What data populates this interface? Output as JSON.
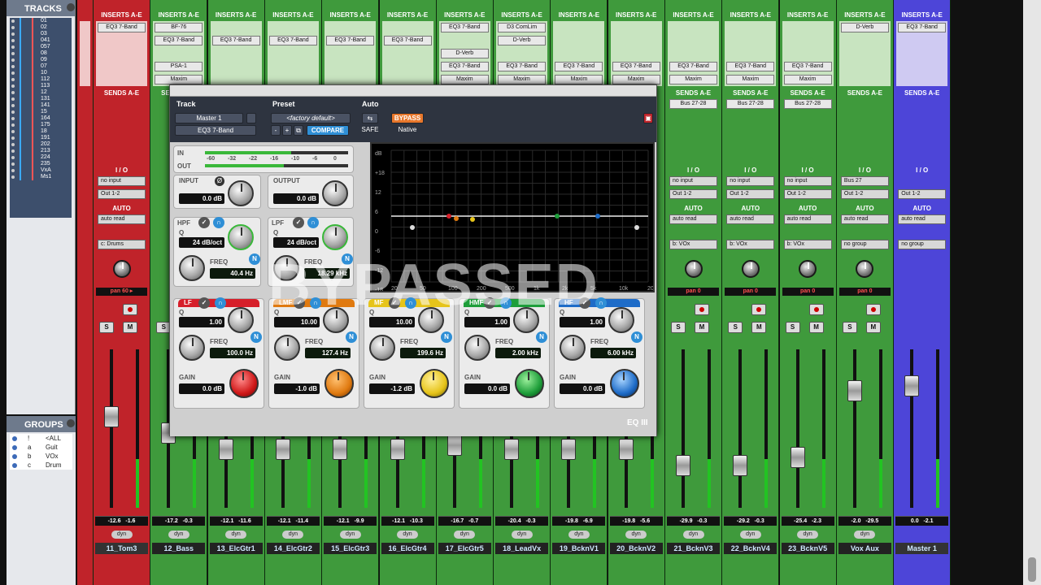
{
  "tracks_panel": {
    "title": "TRACKS",
    "items": [
      "01",
      "02",
      "03",
      "041",
      "057",
      "08",
      "09",
      "07",
      "10",
      "112",
      "113",
      "12",
      "131",
      "141",
      "15",
      "164",
      "175",
      "18",
      "191",
      "202",
      "213",
      "224",
      "235",
      "VxA",
      "Ms1"
    ]
  },
  "groups_panel": {
    "title": "GROUPS",
    "items": [
      {
        "key": "!",
        "name": "<ALL"
      },
      {
        "key": "a",
        "name": "Guit"
      },
      {
        "key": "b",
        "name": "VOx"
      },
      {
        "key": "c",
        "name": "Drum"
      }
    ]
  },
  "common": {
    "inserts_header": "INSERTS A-E",
    "sends_header": "SENDS A-E",
    "io_label": "I / O",
    "auto_label": "AUTO",
    "solo": "S",
    "mute": "M",
    "dyn": "dyn"
  },
  "channels": [
    {
      "name": "11_Tom3",
      "color": "red",
      "inserts": [
        "EQ3 7-Band"
      ],
      "input": "no input",
      "output": "Out 1-2",
      "auto": "auto read",
      "group": "c: Drums",
      "pan": "pan",
      "pan_val": "60 ▸",
      "vol": "-12.6",
      "peak": "-1.6"
    },
    {
      "name": "12_Bass",
      "color": "green",
      "inserts": [
        "BF-76",
        "EQ3 7-Band",
        "",
        "PSA-1",
        "Maxim"
      ],
      "vol": "-17.2",
      "peak": "-0.3"
    },
    {
      "name": "13_ElcGtr1",
      "color": "green",
      "inserts": [
        "",
        "EQ3 7-Band"
      ],
      "vol": "-12.1",
      "peak": "-11.6"
    },
    {
      "name": "14_ElcGtr2",
      "color": "green",
      "inserts": [
        "",
        "EQ3 7-Band"
      ],
      "vol": "-12.1",
      "peak": "-11.4"
    },
    {
      "name": "15_ElcGtr3",
      "color": "green",
      "inserts": [
        "",
        "EQ3 7-Band"
      ],
      "vol": "-12.1",
      "peak": "-9.9"
    },
    {
      "name": "16_ElcGtr4",
      "color": "green",
      "inserts": [
        "",
        "EQ3 7-Band"
      ],
      "vol": "-12.1",
      "peak": "-10.3"
    },
    {
      "name": "17_ElcGtr5",
      "color": "green",
      "inserts": [
        "EQ3 7-Band",
        "",
        "D-Verb",
        "EQ3 7-Band",
        "Maxim"
      ],
      "vol": "-16.7",
      "peak": "-0.7"
    },
    {
      "name": "18_LeadVx",
      "color": "green",
      "inserts": [
        "D3 ComLim",
        "D-Verb",
        "",
        "EQ3 7-Band",
        "Maxim"
      ],
      "vol": "-20.4",
      "peak": "-0.3"
    },
    {
      "name": "19_BcknV1",
      "color": "green",
      "inserts": [
        "",
        "",
        "",
        "EQ3 7-Band",
        "Maxim"
      ],
      "vol": "-19.8",
      "peak": "-6.9"
    },
    {
      "name": "20_BcknV2",
      "color": "green",
      "inserts": [
        "",
        "",
        "",
        "EQ3 7-Band",
        "Maxim"
      ],
      "vol": "-19.8",
      "peak": "-5.6"
    },
    {
      "name": "21_BcknV3",
      "color": "green",
      "inserts": [
        "",
        "",
        "",
        "EQ3 7-Band",
        "Maxim"
      ],
      "sends": "Bus 27-28",
      "input": "no input",
      "output": "Out 1-2",
      "auto": "auto read",
      "group": "b: VOx",
      "pan": "pan",
      "pan_val": "0",
      "vol": "-29.9",
      "peak": "-0.3"
    },
    {
      "name": "22_BcknV4",
      "color": "green",
      "inserts": [
        "",
        "",
        "",
        "EQ3 7-Band",
        "Maxim"
      ],
      "sends": "Bus 27-28",
      "input": "no input",
      "output": "Out 1-2",
      "auto": "auto read",
      "group": "b: VOx",
      "pan": "pan",
      "pan_val": "0",
      "vol": "-29.2",
      "peak": "-0.3"
    },
    {
      "name": "23_BcknV5",
      "color": "green",
      "inserts": [
        "",
        "",
        "",
        "EQ3 7-Band",
        "Maxim"
      ],
      "sends": "Bus 27-28",
      "input": "no input",
      "output": "Out 1-2",
      "auto": "auto read",
      "group": "b: VOx",
      "pan": "pan",
      "pan_val": "0",
      "vol": "-25.4",
      "peak": "-2.3"
    },
    {
      "name": "Vox Aux",
      "color": "green",
      "inserts": [
        "D-Verb"
      ],
      "sends": "",
      "input": "Bus 27",
      "output": "Out 1-2",
      "auto": "auto read",
      "group": "no group",
      "pan": "pan",
      "pan_val": "0",
      "vol": "-2.0",
      "peak": "-29.5"
    },
    {
      "name": "Master 1",
      "color": "master",
      "inserts": [
        "EQ3 7-Band"
      ],
      "sends": "",
      "input": "",
      "output": "Out 1-2",
      "auto": "auto read",
      "group": "no group",
      "vol": "0.0",
      "peak": "-2.1"
    }
  ],
  "plugin": {
    "track_label": "Track",
    "preset_label": "Preset",
    "auto_label": "Auto",
    "track_name": "Master 1",
    "plugin_name": "EQ3 7-Band",
    "preset_name": "<factory default>",
    "bypass": "BYPASS",
    "compare": "COMPARE",
    "safe": "SAFE",
    "native": "Native",
    "in_label": "IN",
    "out_label": "OUT",
    "meter_scale": [
      "-60",
      "-32",
      "-22",
      "-16",
      "-10",
      "-6",
      "0"
    ],
    "input_label": "INPUT",
    "input_val": "0.0 dB",
    "output_label": "OUTPUT",
    "output_val": "0.0 dB",
    "hpf": {
      "label": "HPF",
      "q": "24 dB/oct",
      "freq_label": "FREQ",
      "freq": "40.4 Hz"
    },
    "lpf": {
      "label": "LPF",
      "q": "24 dB/oct",
      "freq_label": "FREQ",
      "freq": "18.29 kHz"
    },
    "q_label": "Q",
    "gain_label": "GAIN",
    "freq_label": "FREQ",
    "bands": [
      {
        "label": "LF",
        "q": "1.00",
        "freq": "100.0 Hz",
        "gain": "0.0 dB",
        "color": "#d61f2a"
      },
      {
        "label": "LMF",
        "q": "10.00",
        "freq": "127.4 Hz",
        "gain": "-1.0 dB",
        "color": "#e07a10"
      },
      {
        "label": "MF",
        "q": "10.00",
        "freq": "199.6 Hz",
        "gain": "-1.2 dB",
        "color": "#e6c41a"
      },
      {
        "label": "HMF",
        "q": "1.00",
        "freq": "2.00 kHz",
        "gain": "0.0 dB",
        "color": "#1e9e3a"
      },
      {
        "label": "HF",
        "q": "1.00",
        "freq": "6.00 kHz",
        "gain": "0.0 dB",
        "color": "#1e6cc8"
      }
    ],
    "graph_db": [
      "dB",
      "+18",
      "12",
      "6",
      "0",
      "-6",
      "-12",
      "-18"
    ],
    "graph_hz": [
      "20",
      "50",
      "100",
      "200",
      "500",
      "1k",
      "2k",
      "5k",
      "10k",
      "20k"
    ],
    "bypassed_text": "BYPASSED",
    "logo": "EQ III"
  }
}
